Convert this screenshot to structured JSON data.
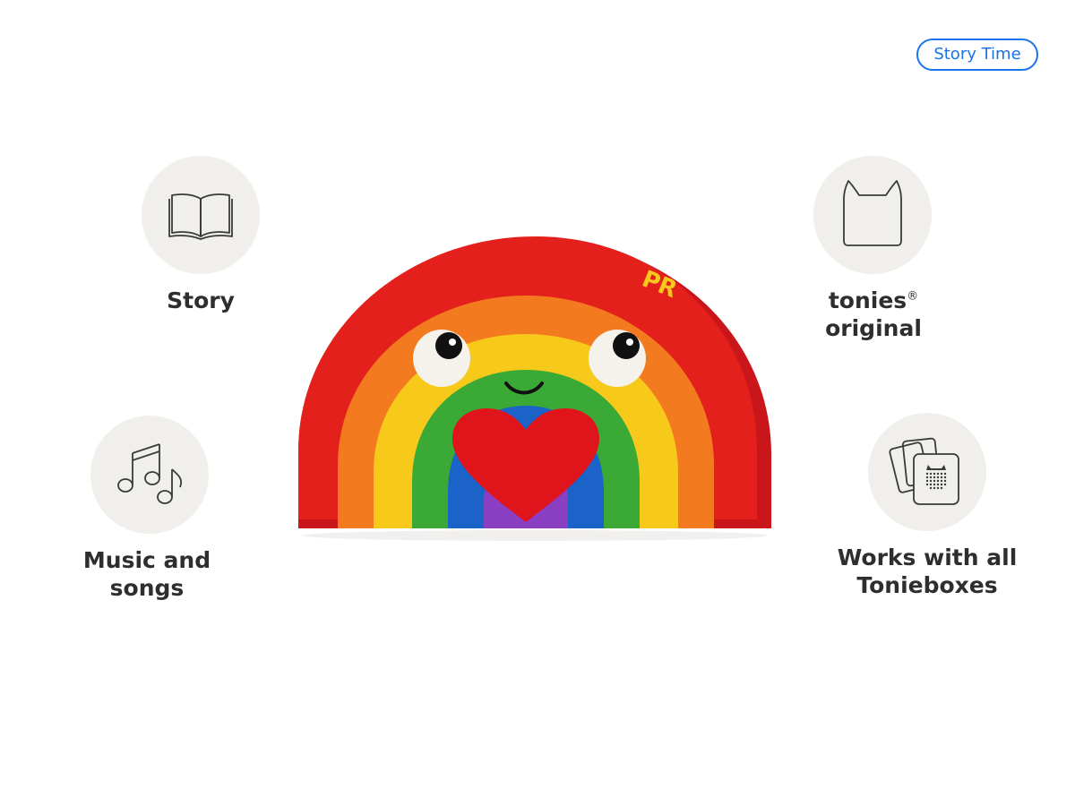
{
  "badge": {
    "label": "Story Time"
  },
  "features": {
    "story": {
      "label": "Story",
      "icon": "open-book-icon"
    },
    "music": {
      "label_line1": "Music and",
      "label_line2": "songs",
      "icon": "music-notes-icon"
    },
    "original": {
      "label_line1": "tonies",
      "trademark": "®",
      "label_line2": "original",
      "icon": "tonie-head-icon"
    },
    "works": {
      "label_line1": "Works with all",
      "label_line2": "Tonieboxes",
      "icon": "toniebox-cards-icon"
    }
  },
  "product": {
    "image": "rainbow-tonie-figure",
    "colors": {
      "red": "#e3201b",
      "orange": "#f47a1f",
      "yellow": "#f7c91a",
      "green": "#3aa935",
      "blue": "#1b63c9",
      "purple": "#8a3fc2",
      "heart": "#e0151c"
    }
  }
}
